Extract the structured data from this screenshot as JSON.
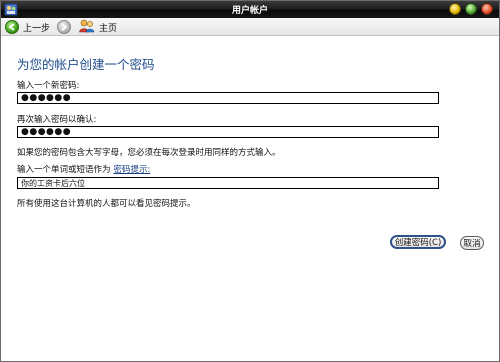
{
  "window": {
    "title": "用户帐户"
  },
  "nav": {
    "back_label": "上一步",
    "home_label": "主页"
  },
  "main": {
    "title": "为您的帐户创建一个密码",
    "new_password_label": "输入一个新密码:",
    "new_password_value": "●●●●●●",
    "confirm_password_label": "再次输入密码以确认:",
    "confirm_password_value": "●●●●●●",
    "caps_note": "如果您的密码包含大写字母，您必须在每次登录时用同样的方式输入。",
    "hint_label_prefix": "输入一个单词或短语作为",
    "hint_link": "密码提示:",
    "hint_value": "你的工资卡后六位",
    "visibility_note": "所有使用这台计算机的人都可以看见密码提示。"
  },
  "buttons": {
    "create_label": "创建密码(C)",
    "cancel_label": "取消"
  },
  "colors": {
    "title_blue": "#1f4e8c",
    "link_blue": "#1a3f86",
    "titlebar": "#1e1e1e"
  }
}
